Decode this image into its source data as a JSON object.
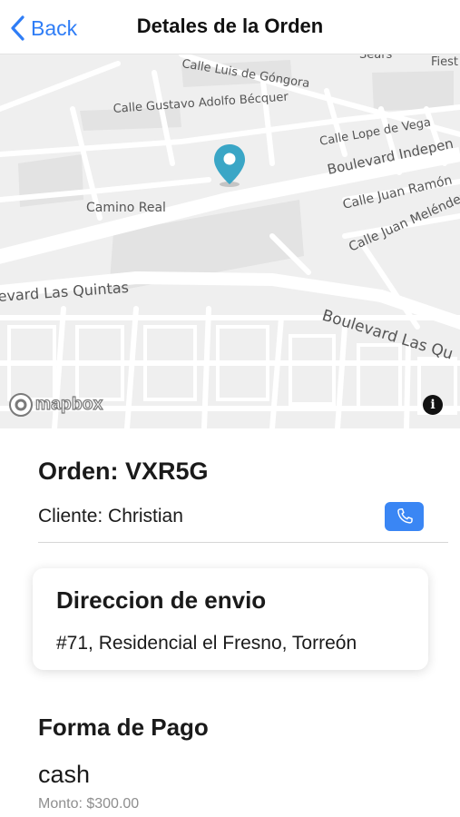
{
  "nav": {
    "back_label": "Back",
    "title": "Detales de la Orden"
  },
  "map": {
    "streets": {
      "luis_de_gongora": "Calle Luis de Góngora",
      "sears": "Sears",
      "fiesta": "Fiest",
      "gustavo_adolfo_becquer": "Calle Gustavo Adolfo Bécquer",
      "lope_de_vega": "Calle Lope de Vega",
      "boulevard_independencia": "Boulevard Indepen",
      "camino_real": "Camino Real",
      "juan_ramon": "Calle Juan Ramón",
      "juan_melendez": "Calle Juan Meléndez",
      "las_quintas_left": "evard Las Quintas",
      "las_quintas_right": "Boulevard Las Qu"
    },
    "logo_text": "mapbox",
    "info_label": "i"
  },
  "order": {
    "title": "Orden: VXR5G",
    "client": "Cliente: Christian"
  },
  "shipping": {
    "title": "Direccion de envio",
    "address": "#71, Residencial el Fresno, Torreón"
  },
  "payment": {
    "title": "Forma de Pago",
    "method": "cash",
    "amount": "Monto: $300.00"
  },
  "colors": {
    "accent": "#2f7df6",
    "call_button": "#3a86f4",
    "pin": "#3aa6c6",
    "map_bg": "#efefef"
  }
}
